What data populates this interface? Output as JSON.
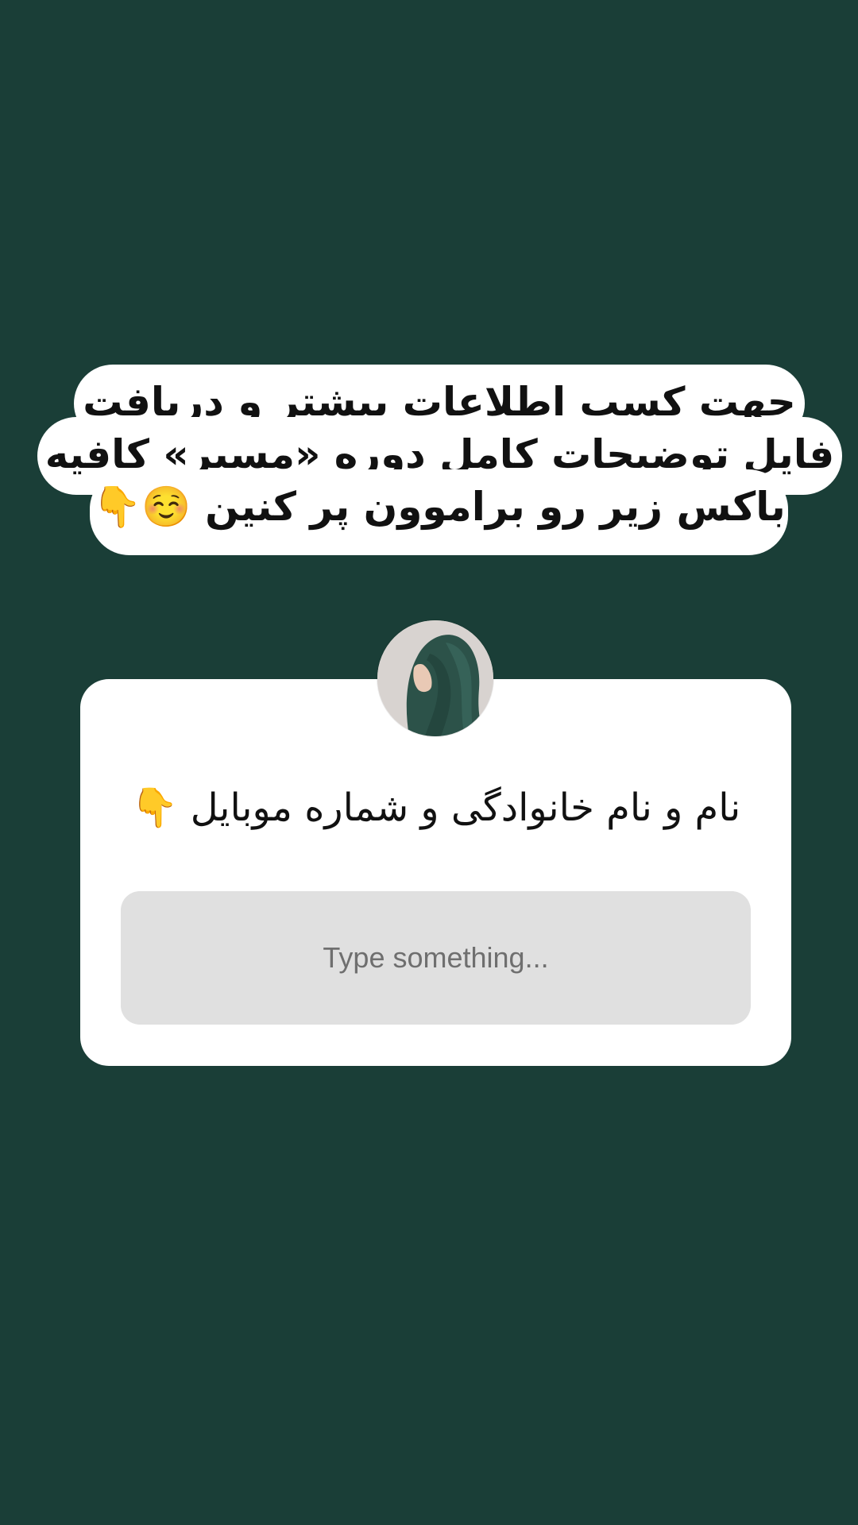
{
  "story": {
    "background_color": "#1a3e37",
    "caption": {
      "lines": [
        "جهت کسب اطلاعات بیشتر و دریافت",
        "فایل توضیحات کامل دوره «مسیر» کافیه",
        "باکس زیر رو براموون پر کنین ☺️👇"
      ]
    },
    "question_box": {
      "avatar_icon": "profile-photo-hijab-woman",
      "question": "نام و نام خانوادگی و شماره موبایل 👇",
      "answer_placeholder": "Type something..."
    }
  }
}
